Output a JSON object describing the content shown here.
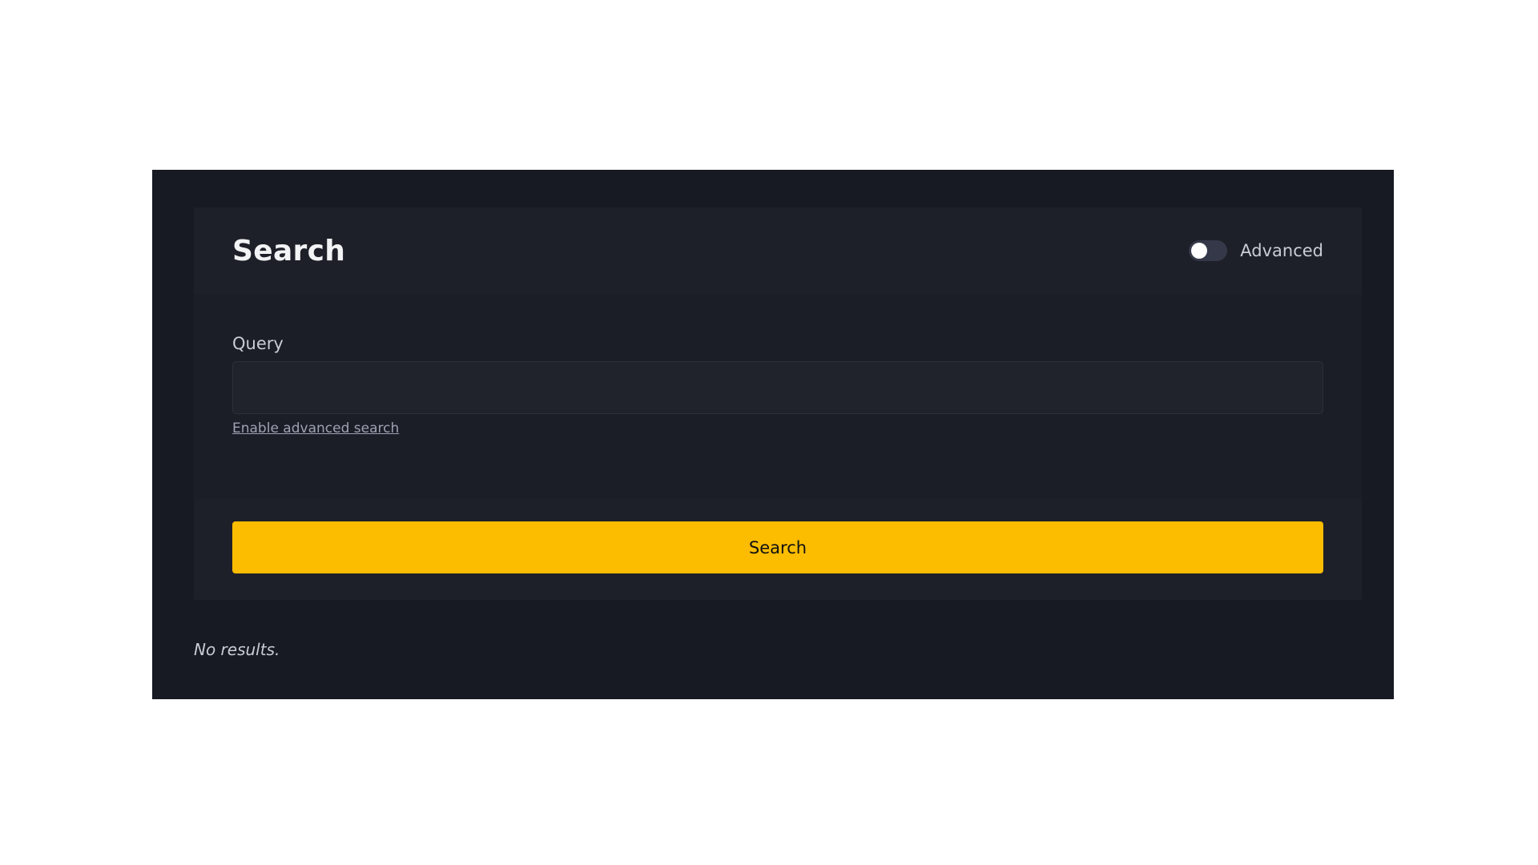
{
  "search_card": {
    "title": "Search",
    "advanced_toggle": {
      "label": "Advanced",
      "enabled": false
    },
    "query": {
      "label": "Query",
      "value": "",
      "placeholder": ""
    },
    "advanced_link": "Enable advanced search",
    "submit_label": "Search"
  },
  "results": {
    "empty_message": "No results."
  },
  "colors": {
    "page_background": "#171923",
    "card_background": "#1b1d27",
    "accent": "#fcbc00",
    "toggle_track": "#343848"
  }
}
